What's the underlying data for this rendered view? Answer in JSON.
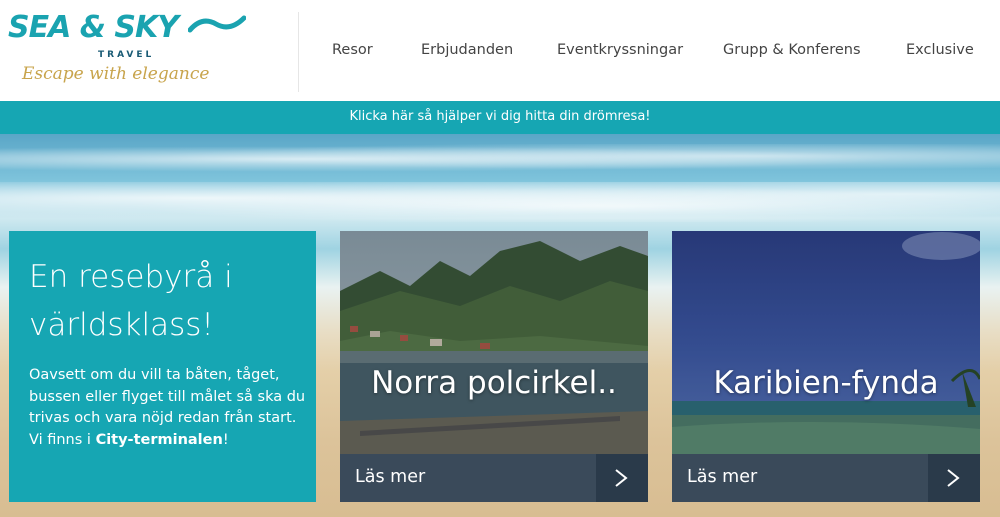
{
  "logo": {
    "brand": "SEA & SKY",
    "sub": "TRAVEL",
    "tagline": "Escape with elegance"
  },
  "nav": {
    "items": [
      "Resor",
      "Erbjudanden",
      "Eventkryssningar",
      "Grupp & Konferens",
      "Exclusive"
    ]
  },
  "banner": {
    "text": "Klicka här så hjälper vi dig hitta din drömresa!"
  },
  "intro": {
    "title": "En resebyrå i världsklass!",
    "text_before": "Oavsett om du vill ta båten, tåget, bussen eller flyget till målet så ska du trivas och vara nöjd redan från start. Vi finns i ",
    "text_bold": "City-terminalen",
    "text_after": "!"
  },
  "cards": [
    {
      "title": "Norra polcirkel..",
      "more": "Läs mer",
      "arrow_icon": "chevron-right-icon"
    },
    {
      "title": "Karibien-fynda",
      "more": "Läs mer",
      "arrow_icon": "chevron-right-icon"
    }
  ],
  "colors": {
    "teal": "#16a6b3",
    "logo_blue": "#1aa3b0",
    "gold": "#c8a44c",
    "card_footer": "#3a4a5a"
  }
}
